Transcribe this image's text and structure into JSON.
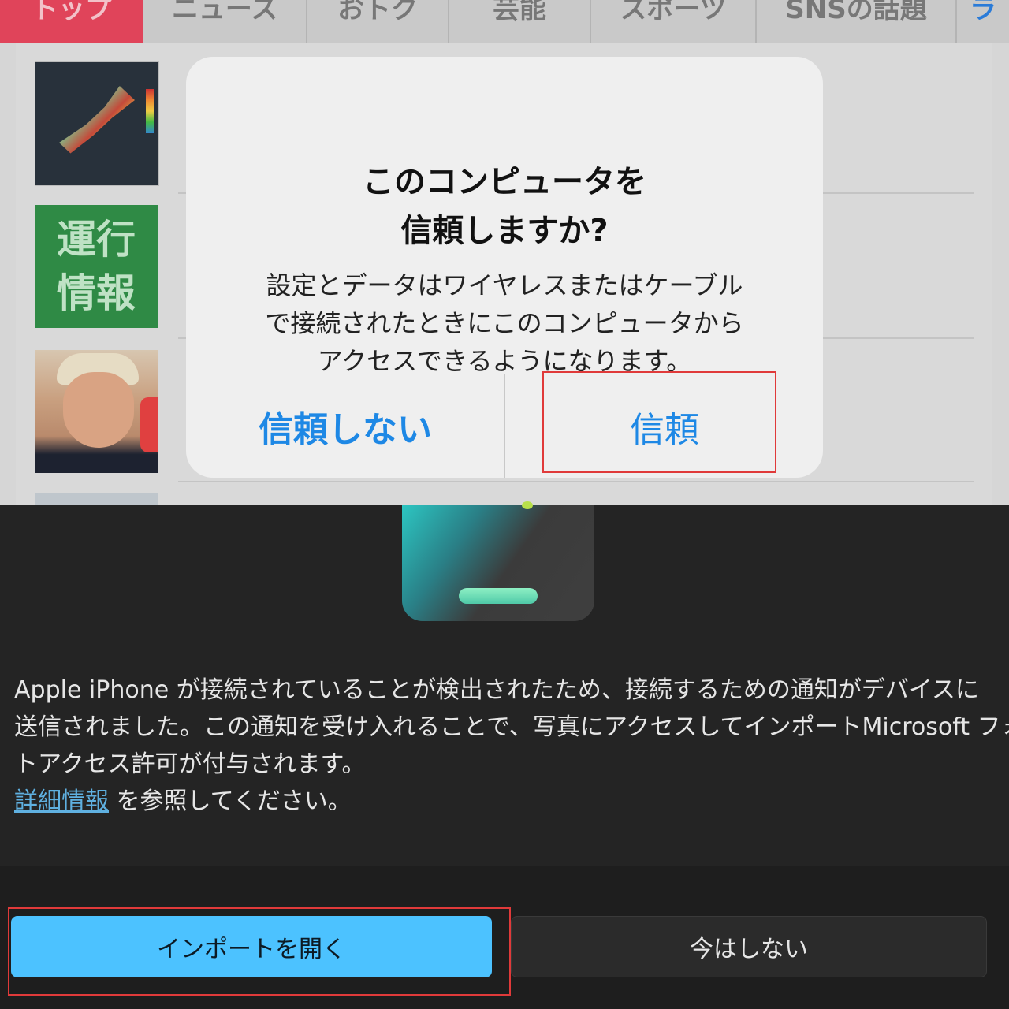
{
  "tabs": [
    {
      "label": "トップ"
    },
    {
      "label": "ニュース"
    },
    {
      "label": "おトク"
    },
    {
      "label": "芸能"
    },
    {
      "label": "スポーツ"
    },
    {
      "label": "SNSの話題"
    },
    {
      "label": "ラ"
    }
  ],
  "feed": {
    "thumb_unko_line1": "運行",
    "thumb_unko_line2": "情報"
  },
  "alert": {
    "title_line1": "このコンピュータを",
    "title_line2": "信頼しますか?",
    "message_line1": "設定とデータはワイヤレスまたはケーブル",
    "message_line2": "で接続されたときにこのコンピュータから",
    "message_line3": "アクセスできるようになります。",
    "dont_trust_label": "信頼しない",
    "trust_label": "信頼"
  },
  "dialog": {
    "desc_line1": "Apple iPhone が接続されていることが検出されたため、接続するための通知がデバイスに",
    "desc_line2": "送信されました。この通知を受け入れることで、写真にアクセスしてインポートMicrosoft フォ",
    "desc_line3": "トアクセス許可が付与されます。",
    "more_info_link": "詳細情報",
    "more_info_suffix": " を参照してください。",
    "import_button": "インポートを開く",
    "not_now_button": "今はしない"
  },
  "colors": {
    "accent_blue": "#4cc2ff",
    "ios_blue": "#1e88e5",
    "highlight_red": "#e03a3a",
    "active_tab": "#e0445a"
  }
}
